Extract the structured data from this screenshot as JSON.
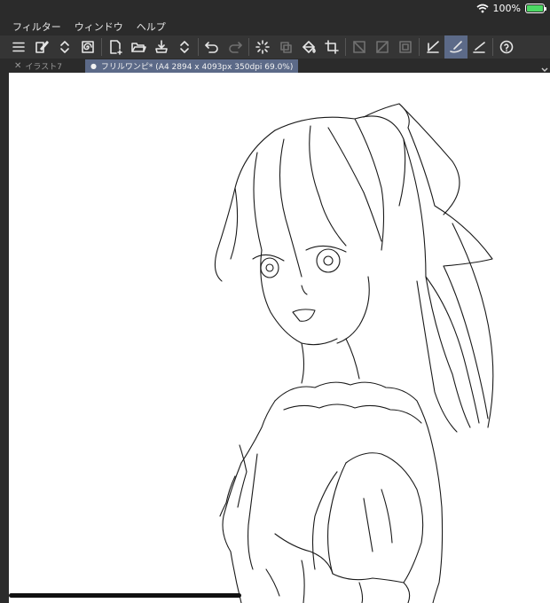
{
  "status": {
    "battery_text": "100%",
    "battery_level": 1.0
  },
  "menu": {
    "items": [
      "フィルター",
      "ウィンドウ",
      "ヘルプ"
    ]
  },
  "tabs": [
    {
      "label": "イラスト7",
      "active": false
    },
    {
      "label": "フリルワンピ* (A4 2894 x 4093px 350dpi 69.0%)",
      "active": true
    }
  ],
  "icons": {
    "menu": "hamburger-icon",
    "new_layer": "edit-layer-icon",
    "stepper": "up-down-chevron-icon",
    "new_canvas": "new-canvas-icon",
    "open": "open-folder-icon",
    "save": "save-icon",
    "undo": "undo-icon",
    "redo": "redo-icon",
    "loading": "spinner-icon",
    "fill": "fill-bucket-icon",
    "crop": "crop-icon",
    "pen_active": "pen-stroke-icon",
    "help": "help-icon"
  },
  "colors": {
    "accent": "#5c6a88",
    "background": "#2b2b2b",
    "toolbar": "#353535",
    "battery": "#4cd964"
  }
}
